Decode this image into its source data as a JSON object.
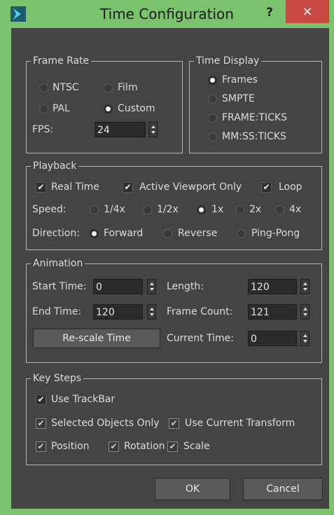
{
  "window": {
    "title": "Time Configuration",
    "help_label": "?",
    "close_label": "×"
  },
  "frame_rate": {
    "title": "Frame Rate",
    "options": [
      "NTSC",
      "Film",
      "PAL",
      "Custom"
    ],
    "selected": "Custom",
    "fps_label": "FPS:",
    "fps_value": "24"
  },
  "time_display": {
    "title": "Time Display",
    "options": [
      "Frames",
      "SMPTE",
      "FRAME:TICKS",
      "MM:SS:TICKS"
    ],
    "selected": "Frames"
  },
  "playback": {
    "title": "Playback",
    "real_time": "Real Time",
    "active_viewport_only": "Active Viewport Only",
    "loop": "Loop",
    "speed_label": "Speed:",
    "speed_options": [
      "1/4x",
      "1/2x",
      "1x",
      "2x",
      "4x"
    ],
    "speed_selected": "1x",
    "direction_label": "Direction:",
    "direction_options": [
      "Forward",
      "Reverse",
      "Ping-Pong"
    ],
    "direction_selected": "Forward"
  },
  "animation": {
    "title": "Animation",
    "start_time_label": "Start Time:",
    "start_time": "0",
    "length_label": "Length:",
    "length": "120",
    "end_time_label": "End Time:",
    "end_time": "120",
    "frame_count_label": "Frame Count:",
    "frame_count": "121",
    "rescale_label": "Re-scale Time",
    "current_time_label": "Current Time:",
    "current_time": "0"
  },
  "key_steps": {
    "title": "Key Steps",
    "use_trackbar": "Use TrackBar",
    "selected_objects_only": "Selected Objects Only",
    "use_current_transform": "Use Current Transform",
    "position": "Position",
    "rotation": "Rotation",
    "scale": "Scale"
  },
  "buttons": {
    "ok": "OK",
    "cancel": "Cancel"
  },
  "colors": {
    "frame": "#7ac26b",
    "client": "#444444",
    "close": "#c84a43"
  },
  "icons": [
    "app-icon",
    "help-icon",
    "close-icon",
    "spinner-icon",
    "checkmark-icon"
  ]
}
